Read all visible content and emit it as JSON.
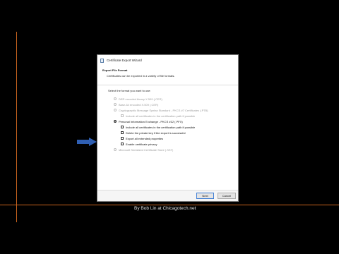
{
  "window": {
    "title": "Certificate Export Wizard"
  },
  "header": {
    "title": "Export File Format",
    "description": "Certificates can be exported in a variety of file formats."
  },
  "prompt": "Select the format you want to use:",
  "options": [
    {
      "label": "DER encoded binary X.509 (.CER)"
    },
    {
      "label": "Base-64 encoded X.509 (.CER)"
    },
    {
      "label": "Cryptographic Message Syntax Standard - PKCS #7 Certificates (.P7B)"
    },
    {
      "label": "Include all certificates in the certification path if possible"
    },
    {
      "label": "Personal Information Exchange - PKCS #12 (.PFX)"
    },
    {
      "label": "Include all certificates in the certification path if possible"
    },
    {
      "label": "Delete the private key if the export is successful"
    },
    {
      "label": "Export all extended properties"
    },
    {
      "label": "Enable certificate privacy"
    },
    {
      "label": "Microsoft Serialized Certificate Store (.SST)"
    }
  ],
  "buttons": {
    "next": "Next",
    "cancel": "Cancel"
  },
  "credit": "By Bob Lin at Chicagotech.net",
  "colors": {
    "arrow": "#2f5fb3",
    "guide": "#c8641e"
  }
}
